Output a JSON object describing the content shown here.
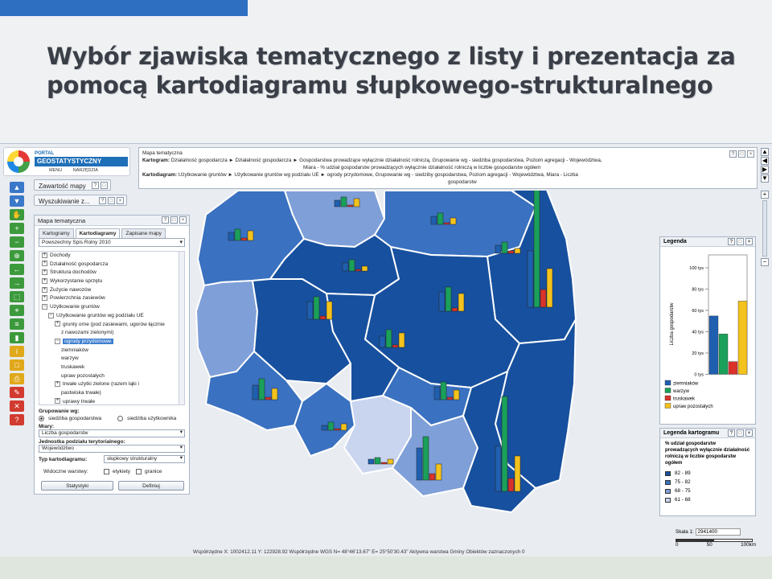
{
  "slide": {
    "title_line1": "Wybór zjawiska tematycznego z listy i prezentacja za",
    "title_line2": "pomocą kartodiagramu słupkowego-strukturalnego"
  },
  "app": {
    "logo_portal": "PORTAL",
    "logo_name": "GEOSTATYSTYCZNY",
    "menu": [
      "MENU",
      "NARZĘDZIA"
    ],
    "panels": {
      "contents": "Zawartość mapy",
      "search": "Wyszukiwanie z...",
      "thematic": "Mapa tematyczna"
    },
    "tabs": [
      "Kartogramy",
      "Kartodiagramy",
      "Zapisane mapy"
    ],
    "dataset": "Powszechny Spis Rolny 2010",
    "tree": [
      {
        "label": "Dochody",
        "exp": "+",
        "lvl": 0
      },
      {
        "label": "Działalność gospodarcza",
        "exp": "+",
        "lvl": 0
      },
      {
        "label": "Struktura dochodów",
        "exp": "+",
        "lvl": 0
      },
      {
        "label": "Wykorzystanie sprzętu",
        "exp": "+",
        "lvl": 0
      },
      {
        "label": "Zużycie nawozów",
        "exp": "+",
        "lvl": 0
      },
      {
        "label": "Powierzchnia zasiewów",
        "exp": "+",
        "lvl": 0
      },
      {
        "label": "Użytkowanie gruntów",
        "exp": "−",
        "lvl": 0
      },
      {
        "label": "Użytkowanie gruntów wg podziału UE",
        "exp": "−",
        "lvl": 1
      },
      {
        "label": "grunty orne (pod zasiewami, ugorów łącznie",
        "exp": "+",
        "lvl": 2
      },
      {
        "label": "z nawozami zielonymi)",
        "exp": "",
        "lvl": 3
      },
      {
        "label": "ogrody przydomowe",
        "exp": "−",
        "lvl": 2,
        "sel": true
      },
      {
        "label": "ziemniaków",
        "exp": "",
        "lvl": 3
      },
      {
        "label": "warzyw",
        "exp": "",
        "lvl": 3
      },
      {
        "label": "truskawek",
        "exp": "",
        "lvl": 3
      },
      {
        "label": "upraw pozostałych",
        "exp": "",
        "lvl": 3
      },
      {
        "label": "trwałe użytki zielone (razem łąki i",
        "exp": "+",
        "lvl": 2
      },
      {
        "label": "pastwiska trwałe)",
        "exp": "",
        "lvl": 3
      },
      {
        "label": "uprawy trwałe",
        "exp": "+",
        "lvl": 2
      },
      {
        "label": "pozostałe użytki rolne",
        "exp": "",
        "lvl": 2
      },
      {
        "label": "lasy i grunty leśne",
        "exp": "+",
        "lvl": 2
      }
    ],
    "grouping_label": "Grupowanie wg:",
    "grouping_opt1": "siedziba gospodarstwa",
    "grouping_opt2": "siedziba użytkownika",
    "measures_label": "Miary:",
    "measure": "Liczba gospodarstw",
    "unit_label": "Jednostka podziału terytorialnego:",
    "unit": "Województwo",
    "diagram_type_label": "Typ kartodiagramu:",
    "diagram_type": "słupkowy strukturalny",
    "visible_layers_label": "Widoczne warstwy:",
    "layer_labels": "etykiety",
    "layer_borders": "granice",
    "stats_button": "Statystyki",
    "define_button": "Definiuj",
    "bc_title": "Mapa tematyczna",
    "bc_kartogram_label": "Kartogram:",
    "bc_kartogram": "Działalność gospodarcza ► Działalność gospodarcza ► Gospodarstwa prowadzące wyłącznie działalność rolniczą, Grupowanie wg - siedziba gospodarstwa, Poziom agregacji - Województwa,",
    "bc_kartogram2": "Miara - % udział gospodarstw prowadzących wyłącznie działalność rolniczą w liczbie gospodarstw ogółem",
    "bc_kartodiagram_label": "Kartodiagram:",
    "bc_kartodiagram": "Użytkowanie gruntów ► Użytkowanie gruntów wg podziału UE ► ogrody przydomowe, Grupowanie wg - siedziby gospodarstwa, Poziom agregacji - Województwa, Miara - Liczba",
    "bc_kartodiagram2": "gospodarstw",
    "legend_title": "Legenda",
    "legend_axis": "Liczba gospodarstw",
    "legend_ticks": [
      "100 tys",
      "80 tys",
      "60 tys",
      "40 tys",
      "20 tys",
      "0 tys"
    ],
    "legend_items": [
      {
        "label": "ziemniaków",
        "color": "#1f5fb0"
      },
      {
        "label": "warzyw",
        "color": "#1aa05a"
      },
      {
        "label": "truskawek",
        "color": "#d9322b"
      },
      {
        "label": "upraw pozostałych",
        "color": "#f3c21c"
      }
    ],
    "lk_title": "Legenda kartogramu",
    "lk_caption": "% udział gospodarstw prowadzących wyłącznie działalność rolniczą w liczbie gospodarstw ogółem",
    "lk_classes": [
      {
        "label": "82 - 89",
        "color": "#17509e"
      },
      {
        "label": "75 - 82",
        "color": "#3a71c0"
      },
      {
        "label": "68 - 75",
        "color": "#7f9fd8"
      },
      {
        "label": "61 - 68",
        "color": "#c9d5ef"
      }
    ],
    "status": "Współrzędne X: 1002412.11 Y: 122928.92   Współrzędne WGS N= 48°46'13.67\" E= 25°50'30.43\"   Aktywna warstwa Gminy   Obiektów zaznaczonych 0",
    "scale_label": "Skala 1:",
    "scale_value": "2941400",
    "scale_ticks": [
      "0",
      "50",
      "100km"
    ]
  },
  "colors": {
    "accent": "#2e6fc2",
    "dark": "#17509e",
    "mid": "#3a71c0",
    "light": "#7f9fd8",
    "lightest": "#c9d5ef"
  }
}
